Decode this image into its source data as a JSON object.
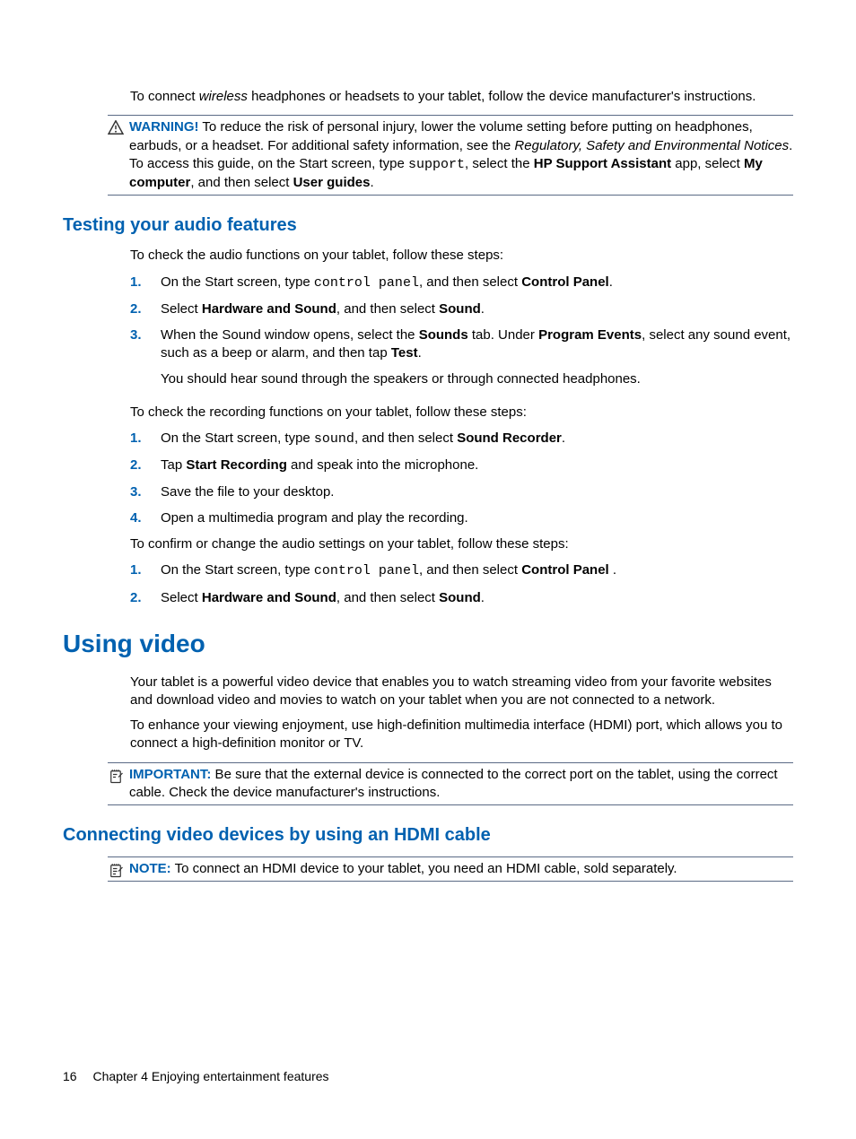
{
  "intro_p1_pre": "To connect ",
  "intro_p1_em": "wireless",
  "intro_p1_post": " headphones or headsets to your tablet, follow the device manufacturer's instructions.",
  "warning": {
    "label": "WARNING!",
    "t1": "   To reduce the risk of personal injury, lower the volume setting before putting on headphones, earbuds, or a headset. For additional safety information, see the ",
    "em": "Regulatory, Safety and Environmental Notices",
    "t2": ". To access this guide, on the Start screen, type ",
    "mono": "support",
    "t3": ", select the ",
    "b1": "HP Support Assistant",
    "t4": " app, select ",
    "b2": "My computer",
    "t5": ", and then select ",
    "b3": "User guides",
    "t6": "."
  },
  "h2a": "Testing your audio features",
  "p2": "To check the audio functions on your tablet, follow these steps:",
  "listA": [
    {
      "num": "1.",
      "pre": "On the Start screen, type ",
      "mono": "control panel",
      "mid": ", and then select ",
      "b": "Control Panel",
      "post": "."
    },
    {
      "num": "2.",
      "pre": "Select ",
      "b1": "Hardware and Sound",
      "mid": ", and then select ",
      "b2": "Sound",
      "post": "."
    },
    {
      "num": "3.",
      "line1_pre": "When the Sound window opens, select the ",
      "line1_b1": "Sounds",
      "line1_mid": " tab. Under ",
      "line1_b2": "Program Events",
      "line1_mid2": ", select any sound event, such as a beep or alarm, and then tap ",
      "line1_b3": "Test",
      "line1_post": ".",
      "line2": "You should hear sound through the speakers or through connected headphones."
    }
  ],
  "p3": "To check the recording functions on your tablet, follow these steps:",
  "listB": [
    {
      "num": "1.",
      "pre": "On the Start screen, type ",
      "mono": "sound",
      "mid": ", and then select ",
      "b": "Sound Recorder",
      "post": "."
    },
    {
      "num": "2.",
      "pre": "Tap ",
      "b": "Start Recording",
      "post": " and speak into the microphone."
    },
    {
      "num": "3.",
      "text": "Save the file to your desktop."
    },
    {
      "num": "4.",
      "text": "Open a multimedia program and play the recording."
    }
  ],
  "p4": "To confirm or change the audio settings on your tablet, follow these steps:",
  "listC": [
    {
      "num": "1.",
      "pre": "On the Start screen, type ",
      "mono": "control panel",
      "mid": ", and then select ",
      "b": "Control Panel",
      "post": " ."
    },
    {
      "num": "2.",
      "pre": "Select ",
      "b1": "Hardware and Sound",
      "mid": ", and then select ",
      "b2": "Sound",
      "post": "."
    }
  ],
  "h1": "Using video",
  "p5": "Your tablet is a powerful video device that enables you to watch streaming video from your favorite websites and download video and movies to watch on your tablet when you are not connected to a network.",
  "p6": "To enhance your viewing enjoyment, use high-definition multimedia interface (HDMI) port, which allows you to connect a high-definition monitor or TV.",
  "important": {
    "label": "IMPORTANT:",
    "text": "   Be sure that the external device is connected to the correct port on the tablet, using the correct cable. Check the device manufacturer's instructions."
  },
  "h2b": "Connecting video devices by using an HDMI cable",
  "note": {
    "label": "NOTE:",
    "text": "   To connect an HDMI device to your tablet, you need an HDMI cable, sold separately."
  },
  "footer": {
    "page": "16",
    "chapter": "Chapter 4   Enjoying entertainment features"
  }
}
